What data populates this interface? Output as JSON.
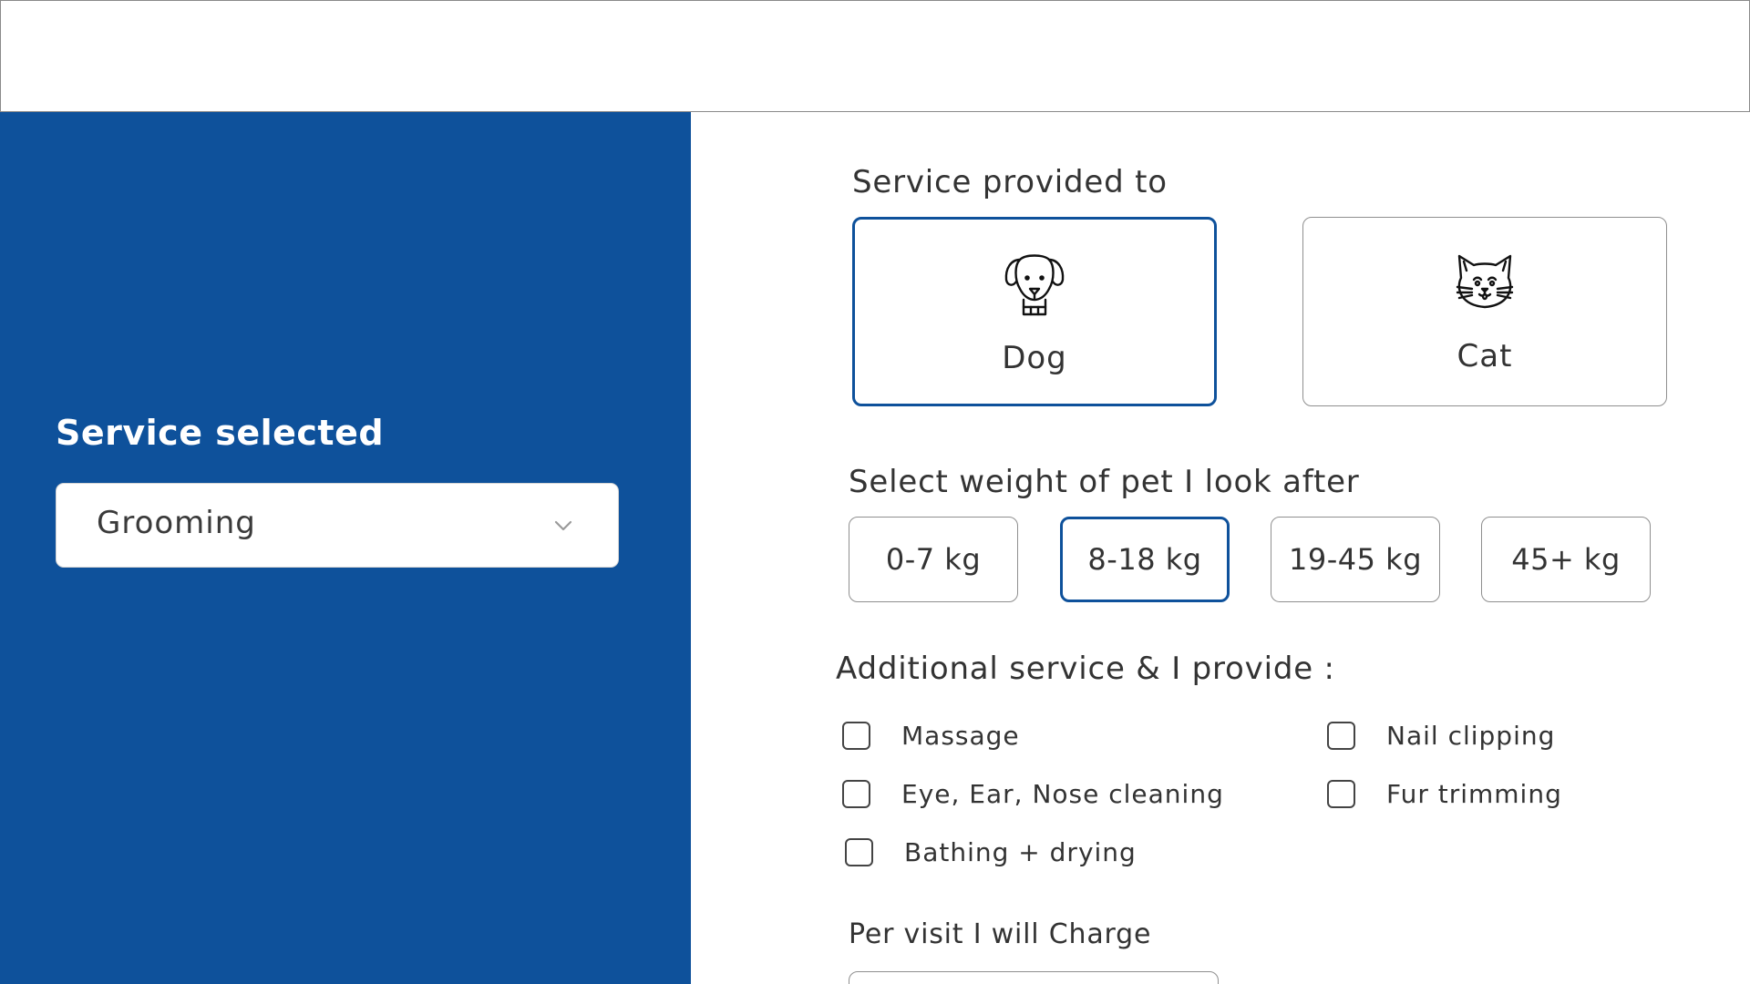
{
  "sidebar": {
    "title": "Service selected",
    "service_select": {
      "value": "Grooming",
      "icon": "chevron-down-icon"
    }
  },
  "main": {
    "service_provided_label": "Service provided to",
    "pets": [
      {
        "label": "Dog",
        "icon": "dog-icon",
        "selected": true
      },
      {
        "label": "Cat",
        "icon": "cat-icon",
        "selected": false
      }
    ],
    "weight_label": "Select weight of pet I look after",
    "weights": [
      {
        "label": "0-7 kg",
        "selected": false
      },
      {
        "label": "8-18 kg",
        "selected": true
      },
      {
        "label": "19-45 kg",
        "selected": false
      },
      {
        "label": "45+ kg",
        "selected": false
      }
    ],
    "additional_label": "Additional service & I provide :",
    "additional_services": [
      {
        "label": "Massage",
        "checked": false
      },
      {
        "label": "Nail clipping",
        "checked": false
      },
      {
        "label": "Eye, Ear, Nose cleaning",
        "checked": false
      },
      {
        "label": "Fur trimming",
        "checked": false
      },
      {
        "label": "Bathing + drying",
        "checked": false
      }
    ],
    "charge_label": "Per visit I will Charge"
  },
  "colors": {
    "brand": "#0e519b",
    "border": "#8f8f8f",
    "text": "#333333"
  }
}
